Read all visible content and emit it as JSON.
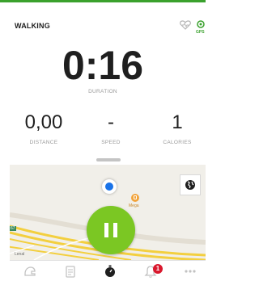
{
  "header": {
    "activity_type": "WALKING",
    "gps_status_label": "GPS"
  },
  "metrics": {
    "duration": {
      "value": "0:16",
      "label": "DURATION"
    },
    "distance": {
      "value": "0,00",
      "label": "DISTANCE"
    },
    "speed": {
      "value": "-",
      "label": "SPEED"
    },
    "calories": {
      "value": "1",
      "label": "CALORIES"
    }
  },
  "map": {
    "poi_name": "Mega",
    "road_badge": "67",
    "place_label": "Lenal",
    "road_color": "#f3cf3f",
    "location_dot_color": "#1a73e8"
  },
  "controls": {
    "pause_button_color": "#7bc723"
  },
  "bottom_nav": {
    "items": [
      {
        "name": "workout-icon"
      },
      {
        "name": "training-plans-icon"
      },
      {
        "name": "stopwatch-icon"
      },
      {
        "name": "notifications-icon",
        "badge_count": "1"
      },
      {
        "name": "more-icon"
      }
    ]
  },
  "colors": {
    "accent": "#3aa12d",
    "badge": "#d9182d"
  }
}
